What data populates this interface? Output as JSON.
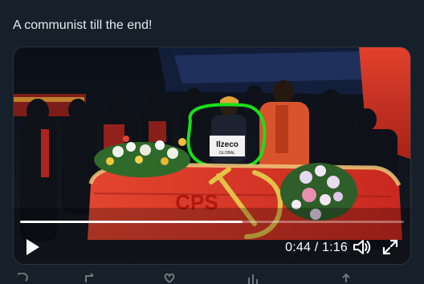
{
  "tweet": {
    "text": "A communist till the end!"
  },
  "video": {
    "time_display": "0:44 / 1:16",
    "progress": 0.58,
    "coffin_label": "CPS",
    "controls": {
      "play_icon": "play-icon",
      "volume_icon": "volume-icon",
      "fullscreen_icon": "fullscreen-icon"
    }
  },
  "actions": [
    "reply-icon",
    "retweet-icon",
    "like-icon",
    "views-icon",
    "share-icon"
  ],
  "colors": {
    "background": "#15202b",
    "text": "#e7e9ea",
    "flag_red": "#d8352b",
    "annotation_green": "#19e01a"
  }
}
